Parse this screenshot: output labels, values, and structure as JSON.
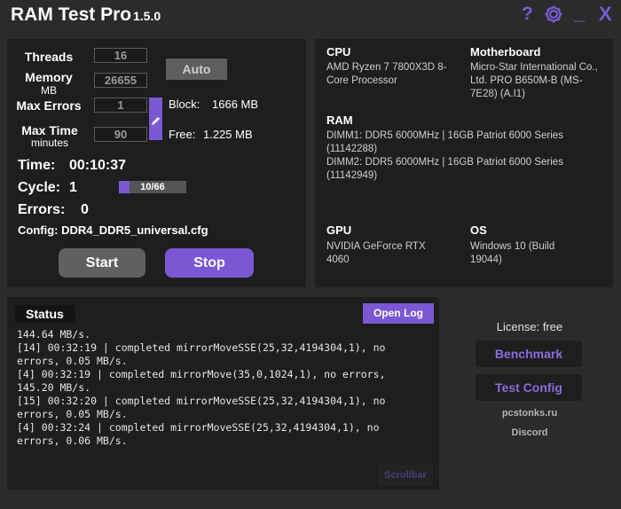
{
  "app": {
    "title": "RAM Test Pro",
    "version": "1.5.0"
  },
  "titlebar": {
    "help": "?",
    "minimize": "_",
    "close": "X"
  },
  "config": {
    "threads_label": "Threads",
    "threads_value": "16",
    "memory_label": "Memory",
    "memory_unit": "MB",
    "memory_value": "26655",
    "max_errors_label": "Max Errors",
    "max_errors_value": "1",
    "max_time_label": "Max Time",
    "max_time_unit": "minutes",
    "max_time_value": "90",
    "auto_label": "Auto",
    "block_label": "Block:",
    "block_value": "1666 MB",
    "free_label": "Free:",
    "free_value": "1.225 MB"
  },
  "stats": {
    "time_label": "Time:",
    "time_value": "00:10:37",
    "cycle_label": "Cycle:",
    "cycle_value": "1",
    "cycle_progress_text": "10/66",
    "cycle_progress": 0.152,
    "errors_label": "Errors:",
    "errors_value": "0",
    "config_text": "Config: DDR4_DDR5_universal.cfg"
  },
  "controls": {
    "start_label": "Start",
    "stop_label": "Stop"
  },
  "system": {
    "cpu_label": "CPU",
    "cpu_value": "AMD Ryzen 7 7800X3D 8-Core Processor",
    "mb_label": "Motherboard",
    "mb_value": "Micro-Star International Co., Ltd. PRO B650M-B (MS-7E28) (A.I1)",
    "ram_label": "RAM",
    "ram_line1": "DIMM1: DDR5 6000MHz | 16GB Patriot 6000 Series (11142288)",
    "ram_line2": "DIMM2: DDR5 6000MHz | 16GB Patriot 6000 Series (11142949)",
    "gpu_label": "GPU",
    "gpu_value": "NVIDIA GeForce RTX 4060",
    "os_label": "OS",
    "os_value": "Windows 10 (Build 19044)"
  },
  "status": {
    "title": "Status",
    "open_log_label": "Open Log",
    "log_lines": [
      "144.64 MB/s.",
      "[14] 00:32:19 | completed mirrorMoveSSE(25,32,4194304,1), no",
      "errors, 0.05 MB/s.",
      "[4] 00:32:19 | completed mirrorMove(35,0,1024,1), no errors,",
      "145.20 MB/s.",
      "[15] 00:32:20 | completed mirrorMoveSSE(25,32,4194304,1), no",
      "errors, 0.05 MB/s.",
      "[4] 00:32:24 | completed mirrorMoveSSE(25,32,4194304,1), no",
      "errors, 0.06 MB/s."
    ],
    "scrollbar_label": "Scrollbar"
  },
  "side": {
    "license": "License: free",
    "benchmark_label": "Benchmark",
    "test_config_label": "Test Config",
    "site": "pcstonks.ru",
    "discord": "Discord"
  },
  "colors": {
    "accent": "#7a58d4",
    "panel": "#1e1e1e",
    "background": "#2b2b2b"
  }
}
